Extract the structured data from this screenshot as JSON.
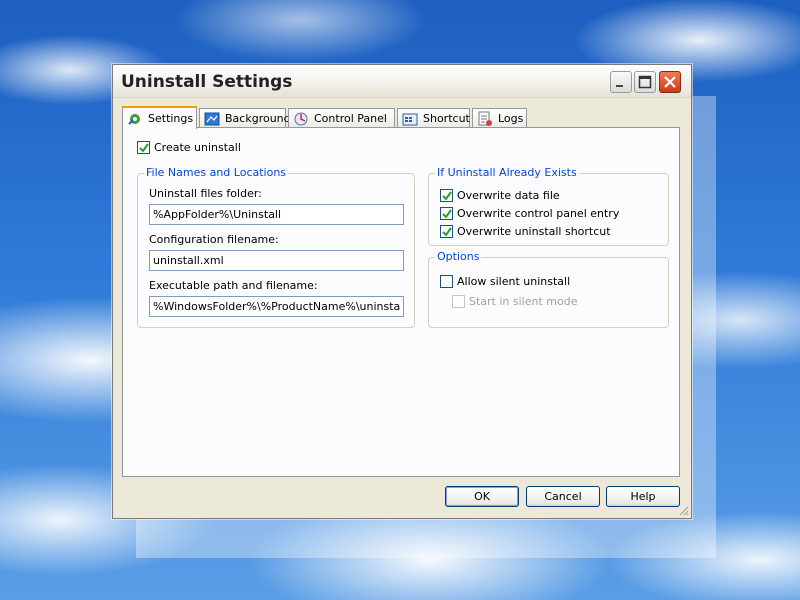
{
  "window": {
    "title": "Uninstall Settings"
  },
  "tabs": [
    {
      "label": "Settings",
      "icon": "settings-icon",
      "active": true
    },
    {
      "label": "Background",
      "icon": "background-icon"
    },
    {
      "label": "Control Panel",
      "icon": "control-panel-icon"
    },
    {
      "label": "Shortcut",
      "icon": "shortcut-icon"
    },
    {
      "label": "Logs",
      "icon": "logs-icon"
    }
  ],
  "settings": {
    "create_uninstall": {
      "label": "Create uninstall",
      "checked": true
    },
    "file_group": {
      "legend": "File Names and Locations",
      "folder_label": "Uninstall files folder:",
      "folder_value": "%AppFolder%\\Uninstall",
      "config_label": "Configuration filename:",
      "config_value": "uninstall.xml",
      "exe_label": "Executable path and filename:",
      "exe_value": "%WindowsFolder%\\%ProductName%\\uninstall.exe"
    },
    "exists_group": {
      "legend": "If Uninstall Already Exists",
      "overwrite_data": {
        "label": "Overwrite data file",
        "checked": true
      },
      "overwrite_cp": {
        "label": "Overwrite control panel entry",
        "checked": true
      },
      "overwrite_shortcut": {
        "label": "Overwrite uninstall shortcut",
        "checked": true
      }
    },
    "options_group": {
      "legend": "Options",
      "allow_silent": {
        "label": "Allow silent uninstall",
        "checked": false
      },
      "start_silent": {
        "label": "Start in silent mode",
        "checked": false,
        "disabled": true
      }
    }
  },
  "buttons": {
    "ok": "OK",
    "cancel": "Cancel",
    "help": "Help"
  },
  "colors": {
    "accent": "#0046d5",
    "tab_highlight": "#f0a000",
    "close_button": "#cc3a1a"
  }
}
